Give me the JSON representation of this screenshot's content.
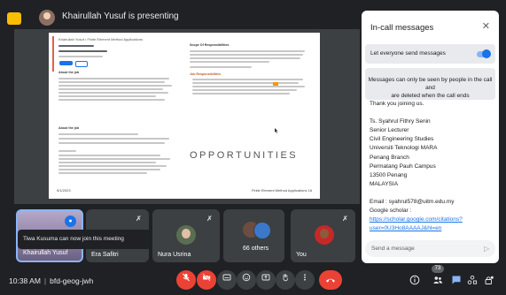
{
  "header": {
    "presenter_text": "Khairullah Yusuf is presenting"
  },
  "slide": {
    "header_text": "Khairullah Yusuf • Finite Element Method Applications",
    "about_job_title": "About the job",
    "about_job_title_2": "About the job",
    "scope_title": "Scope Of Responsibilities",
    "job_reqs_title": "Job Responsibilities",
    "big_word": "OPPORTUNITIES",
    "footer_left": "5/1/2023",
    "footer_right": "Finite Element Method Applications    16"
  },
  "tiles": [
    {
      "name": "Khairullah Yusuf",
      "speaking": true
    },
    {
      "name": "Era Safitri",
      "muted": true
    },
    {
      "name": "Nura Usrina",
      "muted": true
    },
    {
      "name": "66 others"
    },
    {
      "name": "You",
      "muted": true
    }
  ],
  "toast": {
    "text": "Tiwa Kusuma can now join this meeting"
  },
  "bottom_bar": {
    "time": "10:38 AM",
    "meeting_code": "bfd-geog-jwh",
    "participant_count": "73"
  },
  "chat_panel": {
    "title": "In-call messages",
    "toggle_label": "Let everyone send messages",
    "toggle_on": true,
    "info_line1": "Messages can only be seen by people in the call and",
    "info_line2": "are deleted when the call ends",
    "messages": [
      "Thank you joining us.",
      "",
      "Ts. Syahrul Fithry Senin",
      "Senior Lecturer",
      "Civil Engineering Studies",
      "Universiti Teknologi MARA",
      "Penang Branch",
      "Permatang Pauh Campus",
      "13500 Penang",
      "MALAYSIA",
      "",
      "Email : syahrul578@uitm.edu.my",
      "Google scholar :"
    ],
    "links": [
      "https://scholar.google.com/citations?",
      "user=0U3Ho8AAAAJ&hl=en"
    ],
    "input_placeholder": "Send a message"
  },
  "colors": {
    "background": "#202124",
    "accent": "#1a73e8",
    "end_call": "#ea4335",
    "present_icon": "#fbbc04"
  },
  "icons": [
    "present-icon",
    "mic-off-icon",
    "camera-off-icon",
    "captions-icon",
    "emoji-icon",
    "present-now-icon",
    "raise-hand-icon",
    "more-options-icon",
    "end-call-icon",
    "info-icon",
    "people-icon",
    "chat-icon",
    "activities-icon",
    "host-controls-icon",
    "close-icon",
    "send-icon"
  ]
}
